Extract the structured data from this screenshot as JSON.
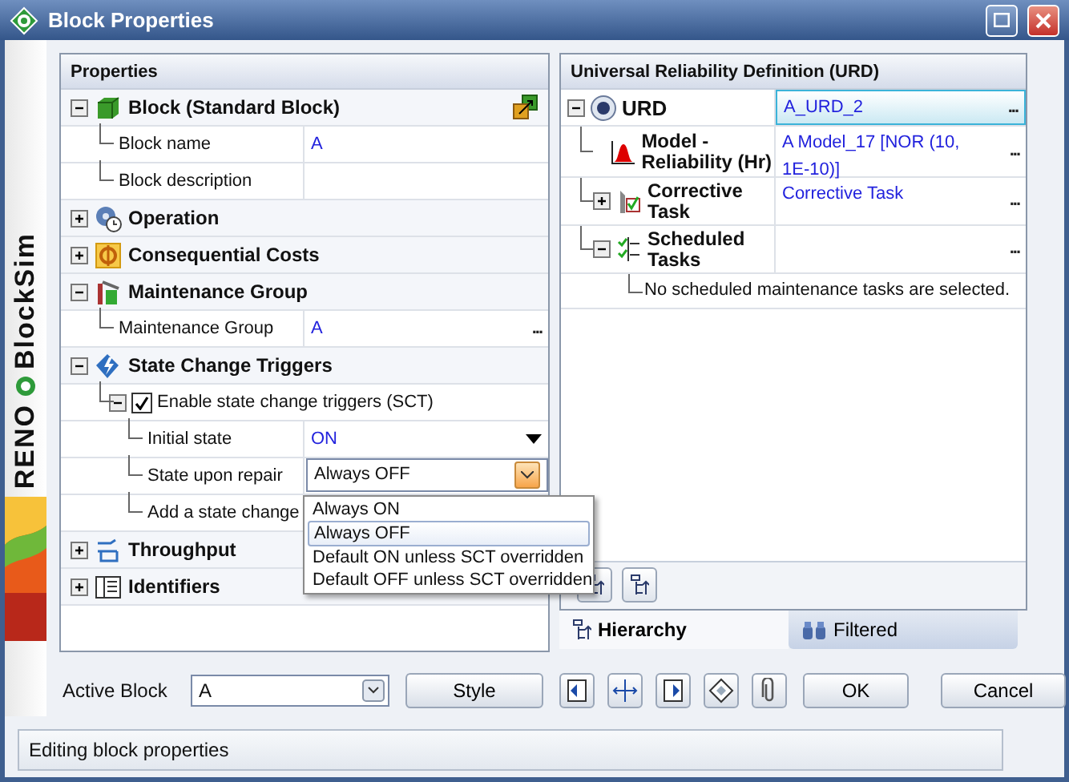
{
  "window": {
    "title": "Block Properties"
  },
  "brand": [
    "BlockSim",
    "RENO"
  ],
  "properties": {
    "title": "Properties",
    "groups": [
      {
        "label": "Block (Standard Block)",
        "expanded": true,
        "tool": true,
        "children": [
          {
            "label": "Block name",
            "value": "A"
          },
          {
            "label": "Block description"
          }
        ]
      },
      {
        "label": "Operation",
        "expanded": false
      },
      {
        "label": "Consequential Costs",
        "expanded": false
      },
      {
        "label": "Maintenance Group",
        "expanded": true,
        "children": [
          {
            "label": "Maintenance Group",
            "value": "A",
            "action": "..."
          }
        ]
      },
      {
        "label": "State Change Triggers",
        "expanded": true,
        "children": [
          {
            "kind": "check",
            "label": "Enable state change triggers (SCT)",
            "checked": true,
            "expanded": true,
            "children": [
              {
                "kind": "select",
                "label": "Initial state",
                "value": "ON"
              },
              {
                "kind": "combo",
                "label": "State upon repair",
                "value": "Always OFF",
                "open": true,
                "options": [
                  {
                    "label": "Always ON",
                    "selected": false
                  },
                  {
                    "label": "Always OFF",
                    "selected": true
                  },
                  {
                    "label": "Default ON unless SCT overridden",
                    "selected": false
                  },
                  {
                    "label": "Default OFF unless SCT overridden",
                    "selected": false
                  }
                ]
              },
              {
                "label": "Add a state change"
              }
            ]
          }
        ]
      },
      {
        "label": "Throughput",
        "expanded": false
      },
      {
        "label": "Identifiers",
        "expanded": false
      }
    ]
  },
  "urd": {
    "title": "Universal Reliability Definition (URD)",
    "root": {
      "label": "URD",
      "value": "A_URD_2",
      "action": "...",
      "selected": true,
      "expanded": true,
      "children": [
        {
          "label": "Model - Reliability (Hr)",
          "value": "A Model_17 [NOR (10, 1E-10)]",
          "action": "..."
        },
        {
          "label": "Corrective Task",
          "expanded": false,
          "value": "Corrective Task",
          "action": "..."
        },
        {
          "label": "Scheduled Tasks",
          "expanded": true,
          "action": "...",
          "note": "No scheduled maintenance tasks are selected."
        }
      ]
    },
    "tabs": [
      {
        "label": "Hierarchy",
        "selected": true
      },
      {
        "label": "Filtered",
        "selected": false
      }
    ]
  },
  "footer": {
    "active_label": "Active Block",
    "active_value": "A",
    "style_button": "Style",
    "ok": "OK",
    "cancel": "Cancel"
  },
  "status_bar": "Editing block properties"
}
